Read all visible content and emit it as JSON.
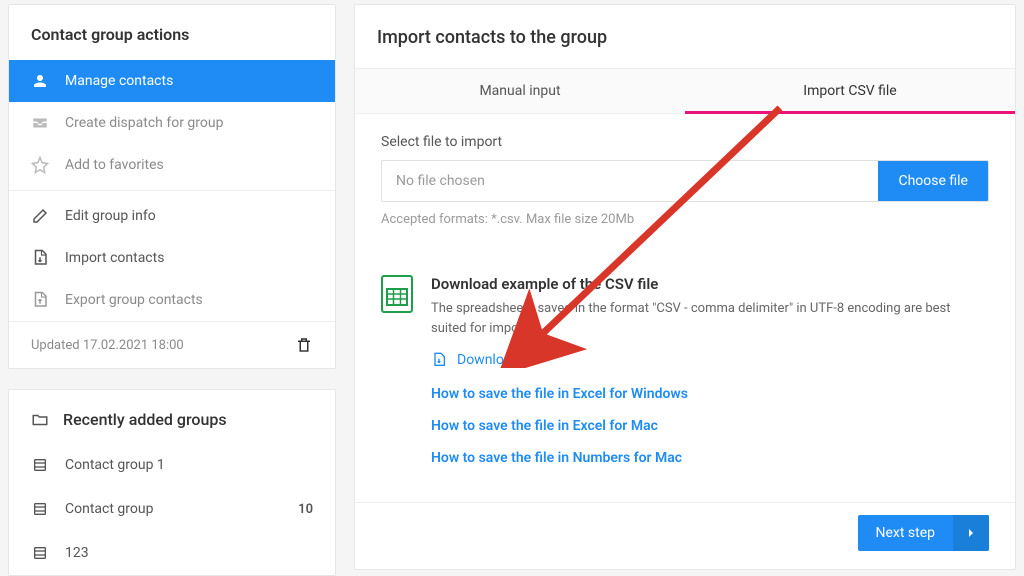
{
  "sidebar": {
    "title": "Contact group actions",
    "items": [
      {
        "label": "Manage contacts",
        "icon": "users-icon",
        "active": true
      },
      {
        "label": "Create dispatch for group",
        "icon": "inbox-icon"
      },
      {
        "label": "Add to favorites",
        "icon": "star-icon"
      },
      {
        "divider": true
      },
      {
        "label": "Edit group info",
        "icon": "edit-icon"
      },
      {
        "label": "Import contacts",
        "icon": "import-icon"
      },
      {
        "label": "Export group contacts",
        "icon": "export-icon"
      }
    ],
    "updated_label": "Updated 17.02.2021 18:00"
  },
  "recent": {
    "title": "Recently added groups",
    "items": [
      {
        "label": "Contact group 1",
        "count": ""
      },
      {
        "label": "Contact group",
        "count": "10"
      },
      {
        "label": "123",
        "count": ""
      }
    ]
  },
  "main": {
    "title": "Import contacts to the group",
    "tabs": {
      "manual": "Manual input",
      "csv": "Import CSV file"
    },
    "select_label": "Select file to import",
    "file_placeholder": "No file chosen",
    "choose_label": "Choose file",
    "accepted_hint": "Accepted formats: *.csv. Max file size 20Mb",
    "example_title": "Download example of the CSV file",
    "example_desc": "The spreadsheets saved in the format \"CSV - comma delimiter\" in UTF-8 encoding are best suited for import",
    "download_label": "Download file",
    "help_links": [
      "How to save the file in Excel for Windows",
      "How to save the file in Excel for Mac",
      "How to save the file in Numbers for Mac"
    ],
    "next_label": "Next step"
  },
  "colors": {
    "primary": "#1e8cf4",
    "accent": "#e9147a",
    "green": "#1e9e4a"
  }
}
